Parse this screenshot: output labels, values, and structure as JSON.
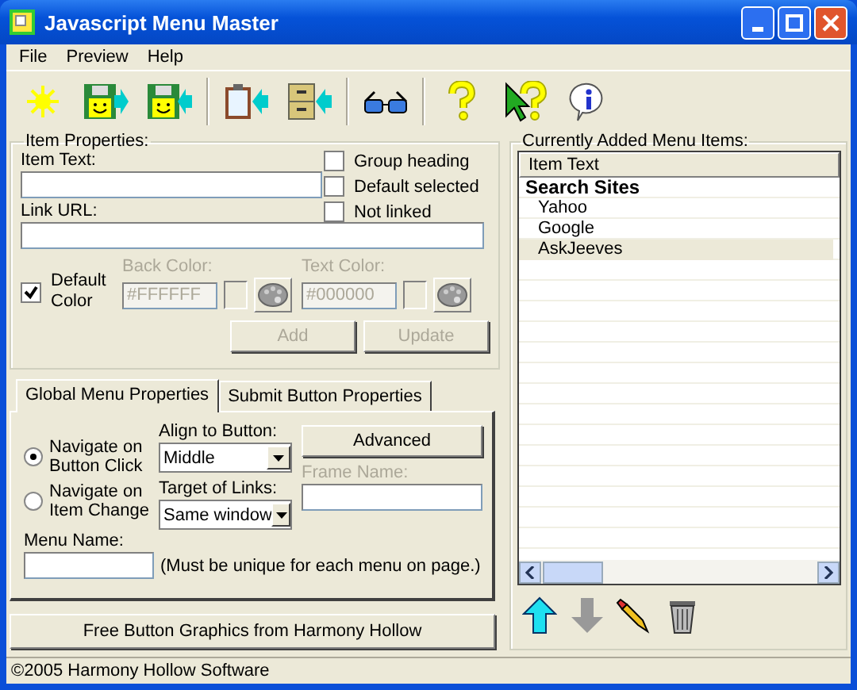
{
  "window": {
    "title": "Javascript Menu Master"
  },
  "menu": [
    "File",
    "Preview",
    "Help"
  ],
  "item_properties": {
    "title": "Item Properties:",
    "item_text": {
      "label": "Item Text:"
    },
    "link_url": {
      "label": "Link URL:"
    },
    "options": [
      {
        "label": "Group heading",
        "checked": false
      },
      {
        "label": "Default selected",
        "checked": false
      },
      {
        "label": "Not linked",
        "checked": false
      }
    ],
    "default_color": {
      "label": "Default Color",
      "checked": true
    },
    "back_color": {
      "label": "Back Color:",
      "value": "#FFFFFF",
      "disabled": true
    },
    "text_color": {
      "label": "Text Color:",
      "value": "#000000",
      "disabled": true
    },
    "buttons": [
      {
        "label": "Add",
        "disabled": true
      },
      {
        "label": "Update",
        "disabled": true
      }
    ]
  },
  "tabs": [
    {
      "label": "Global Menu Properties",
      "selected": true
    },
    {
      "label": "Submit Button Properties",
      "selected": false
    }
  ],
  "global": {
    "navigate": [
      {
        "label": "Navigate on Button Click",
        "selected": true
      },
      {
        "label": "Navigate on Item Change",
        "selected": false
      }
    ],
    "align": {
      "label": "Align to Button:",
      "value": "Middle"
    },
    "advanced": "Advanced",
    "target": {
      "label": "Target of Links:",
      "value": "Same window"
    },
    "frame_name": {
      "label": "Frame Name:",
      "disabled": true
    },
    "menu_name": {
      "label": "Menu Name:"
    },
    "note": "(Must be unique for each menu on page.)"
  },
  "free_button": "Free Button Graphics from Harmony Hollow",
  "status_bar": "©2005 Harmony Hollow Software",
  "menu_items": {
    "title": "Currently Added Menu Items:",
    "column": "Item Text",
    "rows": [
      {
        "text": "Search Sites",
        "selected": false,
        "children": [
          {
            "text": "Yahoo",
            "selected": false
          },
          {
            "text": "Google",
            "selected": false
          },
          {
            "text": "AskJeeves",
            "selected": true
          }
        ]
      }
    ]
  }
}
